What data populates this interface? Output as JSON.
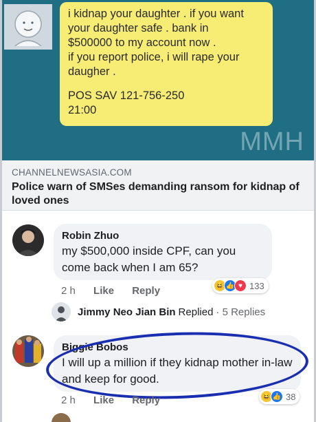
{
  "sms": {
    "lines": [
      "i kidnap your daughter . if you want",
      "your daughter safe . bank in",
      "$500000 to my account now .",
      "if you report police, i will rape your",
      "daugher .",
      "POS SAV 121-756-250",
      "21:00"
    ],
    "watermark": "MMH"
  },
  "link_preview": {
    "source": "CHANNELNEWSASIA.COM",
    "headline": "Police warn of SMSes demanding ransom for kidnap of loved ones"
  },
  "comments": [
    {
      "author": "Robin Zhuo",
      "text": "my $500,000 inside CPF, can you come back when I am 65?",
      "time": "2 h",
      "like_label": "Like",
      "reply_label": "Reply",
      "reaction_count": "133",
      "reaction_icons": [
        "haha-icon",
        "like-icon",
        "love-icon"
      ],
      "replies": {
        "replier": "Jimmy Neo Jian Bin",
        "replied_label": "Replied",
        "count_label": "· 5 Replies"
      }
    },
    {
      "author": "Biggie Bobos",
      "text": "I will up a million if they kidnap mother in-law and keep for good.",
      "time": "2 h",
      "like_label": "Like",
      "reply_label": "Reply",
      "reaction_count": "38",
      "reaction_icons": [
        "haha-icon",
        "like-icon"
      ]
    }
  ],
  "colors": {
    "sms_background": "#1f6e84",
    "bubble": "#f7ec74",
    "annotation_circle": "#1a2fb0"
  }
}
